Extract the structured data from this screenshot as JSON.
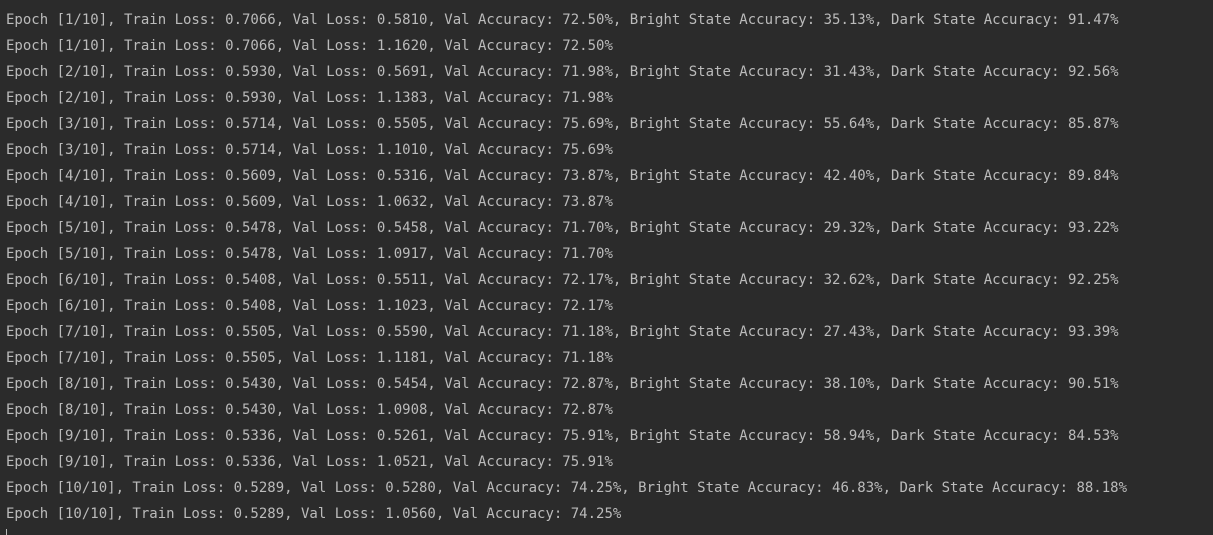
{
  "console": {
    "lines": [
      "Epoch [1/10], Train Loss: 0.7066, Val Loss: 0.5810, Val Accuracy: 72.50%, Bright State Accuracy: 35.13%, Dark State Accuracy: 91.47%",
      "Epoch [1/10], Train Loss: 0.7066, Val Loss: 1.1620, Val Accuracy: 72.50%",
      "Epoch [2/10], Train Loss: 0.5930, Val Loss: 0.5691, Val Accuracy: 71.98%, Bright State Accuracy: 31.43%, Dark State Accuracy: 92.56%",
      "Epoch [2/10], Train Loss: 0.5930, Val Loss: 1.1383, Val Accuracy: 71.98%",
      "Epoch [3/10], Train Loss: 0.5714, Val Loss: 0.5505, Val Accuracy: 75.69%, Bright State Accuracy: 55.64%, Dark State Accuracy: 85.87%",
      "Epoch [3/10], Train Loss: 0.5714, Val Loss: 1.1010, Val Accuracy: 75.69%",
      "Epoch [4/10], Train Loss: 0.5609, Val Loss: 0.5316, Val Accuracy: 73.87%, Bright State Accuracy: 42.40%, Dark State Accuracy: 89.84%",
      "Epoch [4/10], Train Loss: 0.5609, Val Loss: 1.0632, Val Accuracy: 73.87%",
      "Epoch [5/10], Train Loss: 0.5478, Val Loss: 0.5458, Val Accuracy: 71.70%, Bright State Accuracy: 29.32%, Dark State Accuracy: 93.22%",
      "Epoch [5/10], Train Loss: 0.5478, Val Loss: 1.0917, Val Accuracy: 71.70%",
      "Epoch [6/10], Train Loss: 0.5408, Val Loss: 0.5511, Val Accuracy: 72.17%, Bright State Accuracy: 32.62%, Dark State Accuracy: 92.25%",
      "Epoch [6/10], Train Loss: 0.5408, Val Loss: 1.1023, Val Accuracy: 72.17%",
      "Epoch [7/10], Train Loss: 0.5505, Val Loss: 0.5590, Val Accuracy: 71.18%, Bright State Accuracy: 27.43%, Dark State Accuracy: 93.39%",
      "Epoch [7/10], Train Loss: 0.5505, Val Loss: 1.1181, Val Accuracy: 71.18%",
      "Epoch [8/10], Train Loss: 0.5430, Val Loss: 0.5454, Val Accuracy: 72.87%, Bright State Accuracy: 38.10%, Dark State Accuracy: 90.51%",
      "Epoch [8/10], Train Loss: 0.5430, Val Loss: 1.0908, Val Accuracy: 72.87%",
      "Epoch [9/10], Train Loss: 0.5336, Val Loss: 0.5261, Val Accuracy: 75.91%, Bright State Accuracy: 58.94%, Dark State Accuracy: 84.53%",
      "Epoch [9/10], Train Loss: 0.5336, Val Loss: 1.0521, Val Accuracy: 75.91%",
      "Epoch [10/10], Train Loss: 0.5289, Val Loss: 0.5280, Val Accuracy: 74.25%, Bright State Accuracy: 46.83%, Dark State Accuracy: 88.18%",
      "Epoch [10/10], Train Loss: 0.5289, Val Loss: 1.0560, Val Accuracy: 74.25%"
    ]
  },
  "colors": {
    "background": "#2b2b2b",
    "text": "#bbbbbb"
  }
}
